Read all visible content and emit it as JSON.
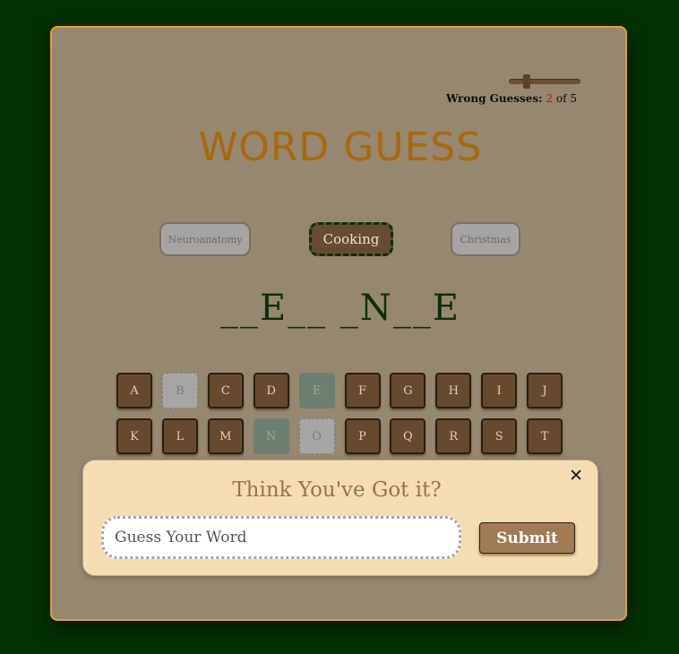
{
  "title": "WORD GUESS",
  "wrong_guesses": {
    "label": "Wrong Guesses:",
    "current": "2",
    "of_text": "of 5",
    "fraction": 0.4
  },
  "categories": [
    {
      "label": "Neuroanatomy",
      "selected": false
    },
    {
      "label": "Cooking",
      "selected": true
    },
    {
      "label": "Christmas",
      "selected": false
    }
  ],
  "word_display": "__E__ _N__E",
  "keyboard": [
    {
      "letter": "A",
      "state": "unused"
    },
    {
      "letter": "B",
      "state": "wrong"
    },
    {
      "letter": "C",
      "state": "unused"
    },
    {
      "letter": "D",
      "state": "unused"
    },
    {
      "letter": "E",
      "state": "correct"
    },
    {
      "letter": "F",
      "state": "unused"
    },
    {
      "letter": "G",
      "state": "unused"
    },
    {
      "letter": "H",
      "state": "unused"
    },
    {
      "letter": "I",
      "state": "unused"
    },
    {
      "letter": "J",
      "state": "unused"
    },
    {
      "letter": "K",
      "state": "unused"
    },
    {
      "letter": "L",
      "state": "unused"
    },
    {
      "letter": "M",
      "state": "unused"
    },
    {
      "letter": "N",
      "state": "correct"
    },
    {
      "letter": "O",
      "state": "wrong"
    },
    {
      "letter": "P",
      "state": "unused"
    },
    {
      "letter": "Q",
      "state": "unused"
    },
    {
      "letter": "R",
      "state": "unused"
    },
    {
      "letter": "S",
      "state": "unused"
    },
    {
      "letter": "T",
      "state": "unused"
    }
  ],
  "guess_popup": {
    "title": "Think You've Got it?",
    "close_icon": "close-icon",
    "close_symbol": "✕",
    "input_placeholder": "Guess Your Word",
    "submit_label": "Submit"
  },
  "colors": {
    "background": "#053105",
    "panel": "#958770",
    "panel_border": "#e8a01c",
    "title": "#a86a0a",
    "key": "#654a30",
    "key_correct": "#6d7f71",
    "key_wrong": "#a6a6a6",
    "popup": "#f4ddb0",
    "submit": "#a07b54"
  }
}
